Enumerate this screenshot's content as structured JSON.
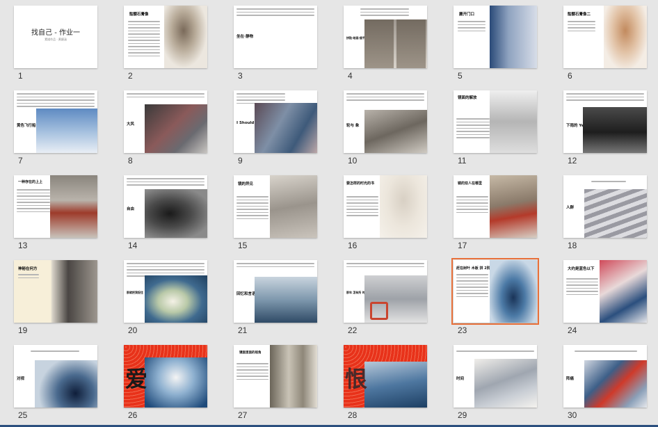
{
  "slides": [
    {
      "number": "1",
      "title": "找自己 - 作业一",
      "subtitle": "素描作品 · 黄婕涵"
    },
    {
      "number": "2",
      "title": "骷髅石膏像"
    },
    {
      "number": "3",
      "title": "坐在·静物"
    },
    {
      "number": "4",
      "title": "拼贴·绘画·细节"
    },
    {
      "number": "5",
      "title": "搬开门口"
    },
    {
      "number": "6",
      "title": "骷髅石膏像二"
    },
    {
      "number": "7",
      "title": "黄色飞行船"
    },
    {
      "number": "8",
      "title": "大风"
    },
    {
      "number": "9",
      "title": "I Should"
    },
    {
      "number": "10",
      "title": "轮与 象"
    },
    {
      "number": "11",
      "title": "镜面的解放"
    },
    {
      "number": "12",
      "title": "下雨的 Yes"
    },
    {
      "number": "13",
      "title": "一种存在的上上"
    },
    {
      "number": "14",
      "title": "自由"
    },
    {
      "number": "15",
      "title": "镜的异见"
    },
    {
      "number": "16",
      "title": "要怎样的时光的书"
    },
    {
      "number": "17",
      "title": "镜的双人在哪里"
    },
    {
      "number": "18",
      "title": "人群"
    },
    {
      "number": "19",
      "title": "神秘在何方"
    },
    {
      "number": "20",
      "title": "那就把我捉住"
    },
    {
      "number": "21",
      "title": "回忆和言语"
    },
    {
      "number": "22",
      "title": "那年 怎有所 时间"
    },
    {
      "number": "23",
      "title": "赶在树叶 木板 拼 2阶"
    },
    {
      "number": "24",
      "title": "大约是蓝色以下"
    },
    {
      "number": "25",
      "title": "对视"
    },
    {
      "number": "26",
      "title": "爱"
    },
    {
      "number": "27",
      "title": "镜面里面的视角"
    },
    {
      "number": "28",
      "title": "恨"
    },
    {
      "number": "29",
      "title": "时间"
    },
    {
      "number": "30",
      "title": "阵痛"
    }
  ],
  "selected_slide": "23",
  "colors": {
    "accent": "#e8703a",
    "bg": "#e6e6e6",
    "bar": "#2b4f7e",
    "red": "#e8321a"
  }
}
